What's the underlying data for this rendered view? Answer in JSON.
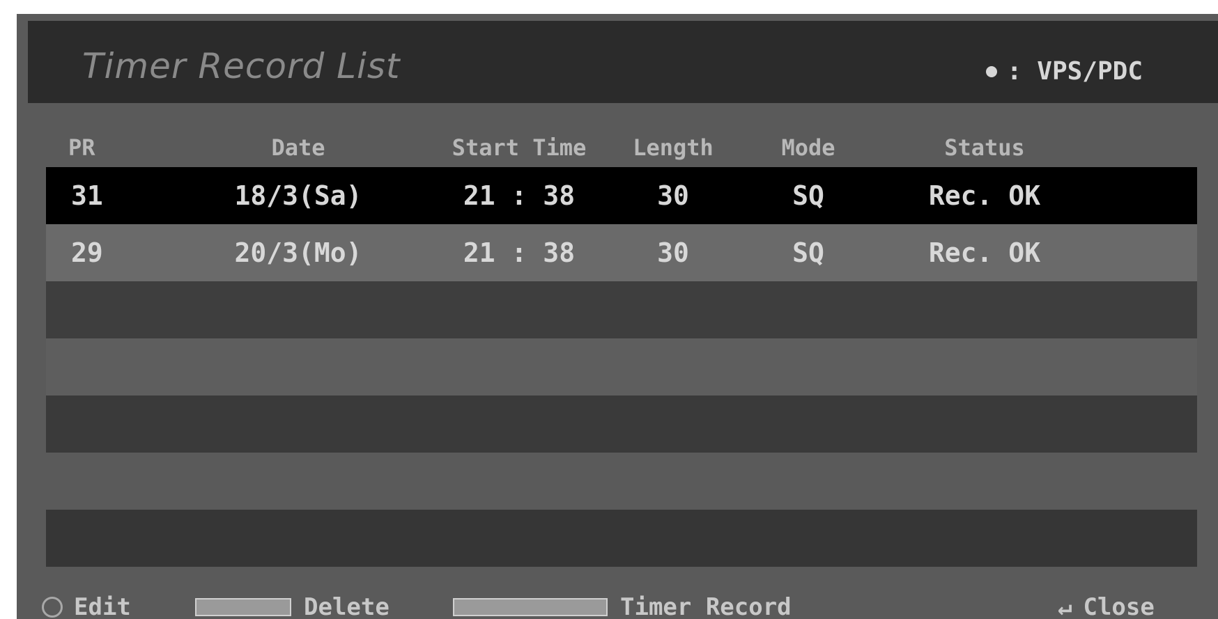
{
  "title": "Timer Record List",
  "vps_label": ": VPS/PDC",
  "columns": {
    "pr": "PR",
    "date": "Date",
    "start": "Start Time",
    "length": "Length",
    "mode": "Mode",
    "status": "Status"
  },
  "rows": [
    {
      "pr": "31",
      "date": "18/3(Sa)",
      "start": "21 : 38",
      "length": "30",
      "mode": "SQ",
      "status": "Rec. OK",
      "selected": true
    },
    {
      "pr": "29",
      "date": "20/3(Mo)",
      "start": "21 : 38",
      "length": "30",
      "mode": "SQ",
      "status": "Rec. OK",
      "selected": false
    }
  ],
  "footer": {
    "edit": "Edit",
    "delete": "Delete",
    "timer_record": "Timer Record",
    "close": "Close"
  },
  "icons": {
    "vps": "dot-icon",
    "edit": "enter-button-icon",
    "delete": "clear-button-icon",
    "timer_record": "record-button-icon",
    "close": "return-icon"
  },
  "colors": {
    "selected_row": "#000000",
    "panel": "#5a5a5a",
    "title_bar": "#2b2b2b"
  }
}
